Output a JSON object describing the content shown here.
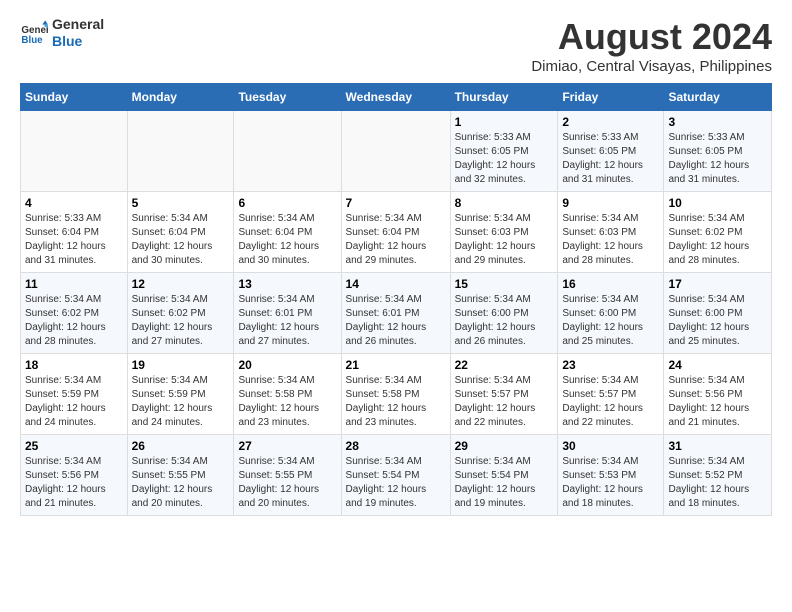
{
  "logo": {
    "line1": "General",
    "line2": "Blue"
  },
  "title": "August 2024",
  "subtitle": "Dimiao, Central Visayas, Philippines",
  "days_header": [
    "Sunday",
    "Monday",
    "Tuesday",
    "Wednesday",
    "Thursday",
    "Friday",
    "Saturday"
  ],
  "weeks": [
    [
      {
        "num": "",
        "detail": ""
      },
      {
        "num": "",
        "detail": ""
      },
      {
        "num": "",
        "detail": ""
      },
      {
        "num": "",
        "detail": ""
      },
      {
        "num": "1",
        "detail": "Sunrise: 5:33 AM\nSunset: 6:05 PM\nDaylight: 12 hours\nand 32 minutes."
      },
      {
        "num": "2",
        "detail": "Sunrise: 5:33 AM\nSunset: 6:05 PM\nDaylight: 12 hours\nand 31 minutes."
      },
      {
        "num": "3",
        "detail": "Sunrise: 5:33 AM\nSunset: 6:05 PM\nDaylight: 12 hours\nand 31 minutes."
      }
    ],
    [
      {
        "num": "4",
        "detail": "Sunrise: 5:33 AM\nSunset: 6:04 PM\nDaylight: 12 hours\nand 31 minutes."
      },
      {
        "num": "5",
        "detail": "Sunrise: 5:34 AM\nSunset: 6:04 PM\nDaylight: 12 hours\nand 30 minutes."
      },
      {
        "num": "6",
        "detail": "Sunrise: 5:34 AM\nSunset: 6:04 PM\nDaylight: 12 hours\nand 30 minutes."
      },
      {
        "num": "7",
        "detail": "Sunrise: 5:34 AM\nSunset: 6:04 PM\nDaylight: 12 hours\nand 29 minutes."
      },
      {
        "num": "8",
        "detail": "Sunrise: 5:34 AM\nSunset: 6:03 PM\nDaylight: 12 hours\nand 29 minutes."
      },
      {
        "num": "9",
        "detail": "Sunrise: 5:34 AM\nSunset: 6:03 PM\nDaylight: 12 hours\nand 28 minutes."
      },
      {
        "num": "10",
        "detail": "Sunrise: 5:34 AM\nSunset: 6:02 PM\nDaylight: 12 hours\nand 28 minutes."
      }
    ],
    [
      {
        "num": "11",
        "detail": "Sunrise: 5:34 AM\nSunset: 6:02 PM\nDaylight: 12 hours\nand 28 minutes."
      },
      {
        "num": "12",
        "detail": "Sunrise: 5:34 AM\nSunset: 6:02 PM\nDaylight: 12 hours\nand 27 minutes."
      },
      {
        "num": "13",
        "detail": "Sunrise: 5:34 AM\nSunset: 6:01 PM\nDaylight: 12 hours\nand 27 minutes."
      },
      {
        "num": "14",
        "detail": "Sunrise: 5:34 AM\nSunset: 6:01 PM\nDaylight: 12 hours\nand 26 minutes."
      },
      {
        "num": "15",
        "detail": "Sunrise: 5:34 AM\nSunset: 6:00 PM\nDaylight: 12 hours\nand 26 minutes."
      },
      {
        "num": "16",
        "detail": "Sunrise: 5:34 AM\nSunset: 6:00 PM\nDaylight: 12 hours\nand 25 minutes."
      },
      {
        "num": "17",
        "detail": "Sunrise: 5:34 AM\nSunset: 6:00 PM\nDaylight: 12 hours\nand 25 minutes."
      }
    ],
    [
      {
        "num": "18",
        "detail": "Sunrise: 5:34 AM\nSunset: 5:59 PM\nDaylight: 12 hours\nand 24 minutes."
      },
      {
        "num": "19",
        "detail": "Sunrise: 5:34 AM\nSunset: 5:59 PM\nDaylight: 12 hours\nand 24 minutes."
      },
      {
        "num": "20",
        "detail": "Sunrise: 5:34 AM\nSunset: 5:58 PM\nDaylight: 12 hours\nand 23 minutes."
      },
      {
        "num": "21",
        "detail": "Sunrise: 5:34 AM\nSunset: 5:58 PM\nDaylight: 12 hours\nand 23 minutes."
      },
      {
        "num": "22",
        "detail": "Sunrise: 5:34 AM\nSunset: 5:57 PM\nDaylight: 12 hours\nand 22 minutes."
      },
      {
        "num": "23",
        "detail": "Sunrise: 5:34 AM\nSunset: 5:57 PM\nDaylight: 12 hours\nand 22 minutes."
      },
      {
        "num": "24",
        "detail": "Sunrise: 5:34 AM\nSunset: 5:56 PM\nDaylight: 12 hours\nand 21 minutes."
      }
    ],
    [
      {
        "num": "25",
        "detail": "Sunrise: 5:34 AM\nSunset: 5:56 PM\nDaylight: 12 hours\nand 21 minutes."
      },
      {
        "num": "26",
        "detail": "Sunrise: 5:34 AM\nSunset: 5:55 PM\nDaylight: 12 hours\nand 20 minutes."
      },
      {
        "num": "27",
        "detail": "Sunrise: 5:34 AM\nSunset: 5:55 PM\nDaylight: 12 hours\nand 20 minutes."
      },
      {
        "num": "28",
        "detail": "Sunrise: 5:34 AM\nSunset: 5:54 PM\nDaylight: 12 hours\nand 19 minutes."
      },
      {
        "num": "29",
        "detail": "Sunrise: 5:34 AM\nSunset: 5:54 PM\nDaylight: 12 hours\nand 19 minutes."
      },
      {
        "num": "30",
        "detail": "Sunrise: 5:34 AM\nSunset: 5:53 PM\nDaylight: 12 hours\nand 18 minutes."
      },
      {
        "num": "31",
        "detail": "Sunrise: 5:34 AM\nSunset: 5:52 PM\nDaylight: 12 hours\nand 18 minutes."
      }
    ]
  ]
}
